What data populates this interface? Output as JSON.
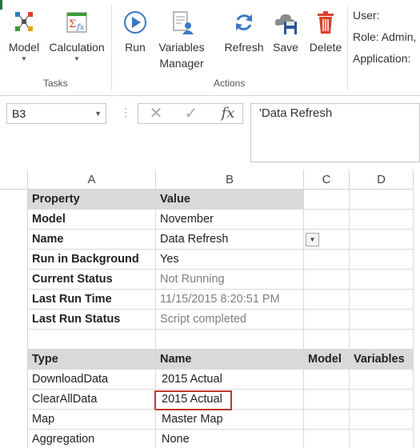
{
  "ribbon": {
    "groups": {
      "tasks": "Tasks",
      "actions": "Actions"
    },
    "buttons": {
      "model": "Model",
      "calculation": "Calculation",
      "run": "Run",
      "variables_manager_1": "Variables",
      "variables_manager_2": "Manager",
      "refresh": "Refresh",
      "save": "Save",
      "delete": "Delete"
    },
    "info": {
      "user": "User:",
      "role": "Role: Admin,",
      "application": "Application:"
    }
  },
  "formula_bar": {
    "name_box": "B3",
    "formula": "'Data Refresh"
  },
  "sheet": {
    "columns": [
      "A",
      "B",
      "C",
      "D"
    ],
    "properties_header": {
      "property": "Property",
      "value": "Value"
    },
    "properties": [
      {
        "property": "Model",
        "value": "November"
      },
      {
        "property": "Name",
        "value": "Data Refresh"
      },
      {
        "property": "Run in Background",
        "value": "Yes"
      },
      {
        "property": "Current Status",
        "value": "Not Running"
      },
      {
        "property": "Last Run Time",
        "value": "11/15/2015 8:20:51 PM"
      },
      {
        "property": "Last Run Status",
        "value": "Script completed"
      }
    ],
    "steps_header": {
      "type": "Type",
      "name": "Name",
      "model": "Model",
      "variables": "Variables"
    },
    "steps": [
      {
        "type": "DownloadData",
        "name": "2015 Actual"
      },
      {
        "type": "ClearAllData",
        "name": "2015 Actual"
      },
      {
        "type": "Map",
        "name": "Master Map"
      },
      {
        "type": "Aggregation",
        "name": "None"
      }
    ]
  },
  "colors": {
    "header_fill": "#d9d9d9",
    "selection_border": "#c0392b",
    "icon_blue": "#3b78c2",
    "icon_red": "#d9412b",
    "excel_green": "#217346"
  }
}
